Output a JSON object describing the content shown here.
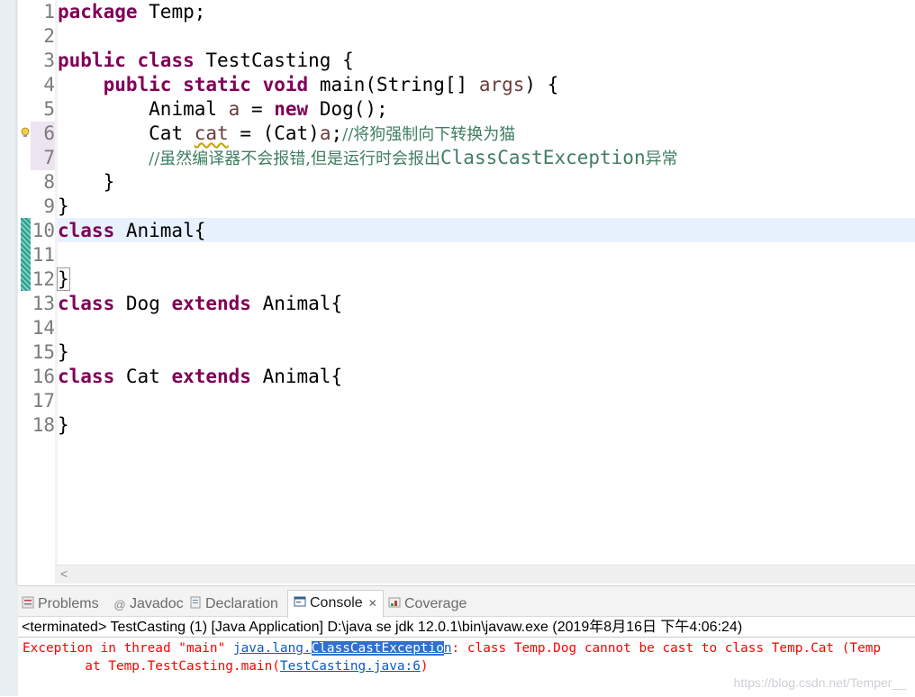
{
  "editor": {
    "lines": [
      {
        "num": "1"
      },
      {
        "num": "2"
      },
      {
        "num": "3"
      },
      {
        "num": "4"
      },
      {
        "num": "5"
      },
      {
        "num": "6"
      },
      {
        "num": "7"
      },
      {
        "num": "8"
      },
      {
        "num": "9"
      },
      {
        "num": "10"
      },
      {
        "num": "11"
      },
      {
        "num": "12"
      },
      {
        "num": "13"
      },
      {
        "num": "14"
      },
      {
        "num": "15"
      },
      {
        "num": "16"
      },
      {
        "num": "17"
      },
      {
        "num": "18"
      }
    ],
    "code": {
      "l1_kw": "package",
      "l1_rest": " Temp;",
      "l3_kw1": "public",
      "l3_kw2": "class",
      "l3_rest": " TestCasting {",
      "l4_kw1": "public",
      "l4_kw2": "static",
      "l4_kw3": "void",
      "l4_a": " main(String[] ",
      "l4_var": "args",
      "l4_b": ") {",
      "l5_a": "Animal ",
      "l5_var": "a",
      "l5_b": " = ",
      "l5_kw": "new",
      "l5_c": " Dog();",
      "l6_a": "Cat ",
      "l6_var": "cat",
      "l6_b": " = (Cat)",
      "l6_var2": "a",
      "l6_c": ";",
      "l6_cm": "//将狗强制向下转换为猫",
      "l7_cm1": "//虽然编译器不会报错,但是运行时会报出",
      "l7_cm2": "ClassCastException",
      "l7_cm3": "异常",
      "l8": "}",
      "l9": "}",
      "l10_kw": "class",
      "l10_rest": " Animal{",
      "l12": "}",
      "l13_kw1": "class",
      "l13_a": " Dog ",
      "l13_kw2": "extends",
      "l13_b": " Animal{",
      "l15": "}",
      "l16_kw1": "class",
      "l16_a": " Cat ",
      "l16_kw2": "extends",
      "l16_b": " Animal{",
      "l18": "}"
    },
    "scroll_arrow": "<"
  },
  "panel": {
    "tabs": [
      {
        "label": "Problems",
        "icon": "problems-icon"
      },
      {
        "label": "Javadoc",
        "icon": "javadoc-icon"
      },
      {
        "label": "Declaration",
        "icon": "declaration-icon"
      },
      {
        "label": "Console",
        "icon": "console-icon",
        "active": true,
        "close": "✕"
      },
      {
        "label": "Coverage",
        "icon": "coverage-icon"
      }
    ],
    "terminated": "<terminated> TestCasting (1) [Java Application] D:\\java se jdk 12.0.1\\bin\\javaw.exe (2019年8月16日 下午4:06:24)",
    "err1_a": "Exception in thread \"main\" ",
    "err1_link1": "java.lang.",
    "err1_sel": "ClassCastExceptio",
    "err1_link2": "n",
    "err1_b": ": class Temp.Dog cannot be cast to class Temp.Cat (Temp",
    "err2_a": "        at Temp.TestCasting.main(",
    "err2_link": "TestCasting.java:6",
    "err2_b": ")"
  },
  "watermark": "https://blog.csdn.net/Temper__",
  "colors": {
    "keyword": "#7f0055",
    "comment": "#3f7f5f",
    "variable": "#6a3e3e",
    "error": "#ff0000",
    "link": "#0b5ac0",
    "current_line": "#e8f2fe"
  }
}
